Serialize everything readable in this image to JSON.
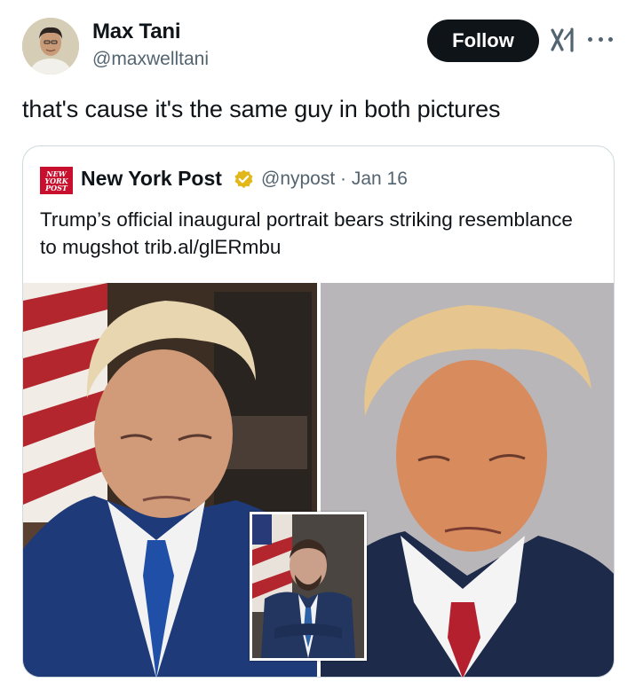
{
  "tweet": {
    "author": {
      "name": "Max Tani",
      "handle": "@maxwelltani"
    },
    "follow_label": "Follow",
    "text": "that's cause it's the same guy in both pictures",
    "icons": {
      "brand": "grok-icon",
      "more": "more-icon"
    }
  },
  "quote": {
    "logo_lines": [
      "NEW",
      "YORK",
      "POST"
    ],
    "name": "New York Post",
    "verified": true,
    "handle_date": "@nypost · Jan 16",
    "text": "Trump’s official inaugural portrait bears striking resemblance to mugshot trib.al/glERmbu",
    "colors": {
      "brand_red": "#c8102e",
      "verified_gold": "#e2b719"
    }
  }
}
